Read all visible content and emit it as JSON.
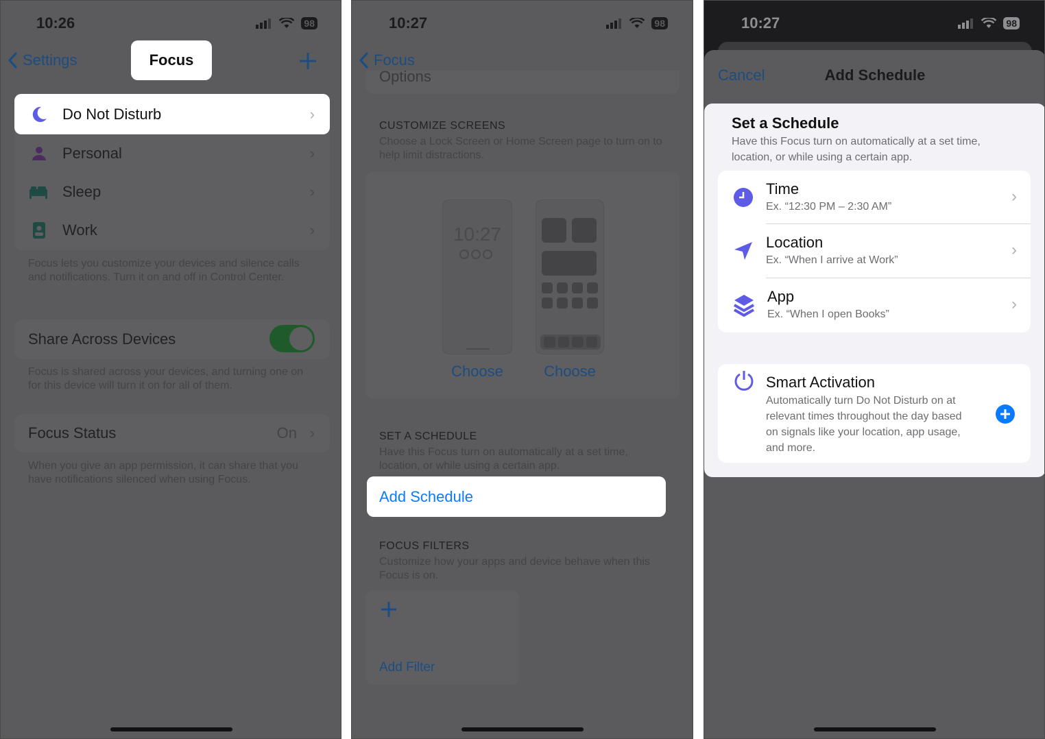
{
  "status": {
    "p1_time": "10:26",
    "p2_time": "10:27",
    "p3_time": "10:27",
    "battery": "98"
  },
  "panel1": {
    "back_label": "Settings",
    "title": "Focus",
    "add_icon": "plus-icon",
    "focus_modes": [
      {
        "label": "Do Not Disturb",
        "icon": "moon-icon"
      },
      {
        "label": "Personal",
        "icon": "person-icon"
      },
      {
        "label": "Sleep",
        "icon": "bed-icon"
      },
      {
        "label": "Work",
        "icon": "id-badge-icon"
      }
    ],
    "focus_note": "Focus lets you customize your devices and silence calls and notifications. Turn it on and off in Control Center.",
    "share_label": "Share Across Devices",
    "share_on": true,
    "share_note": "Focus is shared across your devices, and turning one on for this device will turn it on for all of them.",
    "status_label": "Focus Status",
    "status_value": "On",
    "status_note": "When you give an app permission, it can share that you have notifications silenced when using Focus."
  },
  "panel2": {
    "back_label": "Focus",
    "cut_label": "Options",
    "customize_header": "CUSTOMIZE SCREENS",
    "customize_note": "Choose a Lock Screen or Home Screen page to turn on to help limit distractions.",
    "lock_preview_time": "10:27",
    "choose_lock": "Choose",
    "choose_home": "Choose",
    "schedule_header": "SET A SCHEDULE",
    "schedule_note": "Have this Focus turn on automatically at a set time, location, or while using a certain app.",
    "add_schedule": "Add Schedule",
    "filters_header": "FOCUS FILTERS",
    "filters_note": "Customize how your apps and device behave when this Focus is on.",
    "add_filter_icon": "plus-icon",
    "add_filter": "Add Filter"
  },
  "panel3": {
    "cancel": "Cancel",
    "title": "Add Schedule",
    "section_title": "Set a Schedule",
    "section_note": "Have this Focus turn on automatically at a set time, location, or while using a certain app.",
    "options": [
      {
        "label": "Time",
        "example": "Ex. “12:30 PM – 2:30 AM”",
        "icon": "clock-icon"
      },
      {
        "label": "Location",
        "example": "Ex. “When I arrive at Work”",
        "icon": "location-arrow-icon"
      },
      {
        "label": "App",
        "example": "Ex. “When I open Books”",
        "icon": "layers-icon"
      }
    ],
    "smart_title": "Smart Activation",
    "smart_note": "Automatically turn Do Not Disturb on at relevant times throughout the day based on signals like your location, app usage, and more.",
    "smart_icon": "power-icon",
    "smart_add_icon": "plus-circle-icon"
  },
  "colors": {
    "accent_blue": "#0a7aff",
    "purple_icon": "#5e5ce6",
    "toggle_green": "#1f5a2a"
  }
}
